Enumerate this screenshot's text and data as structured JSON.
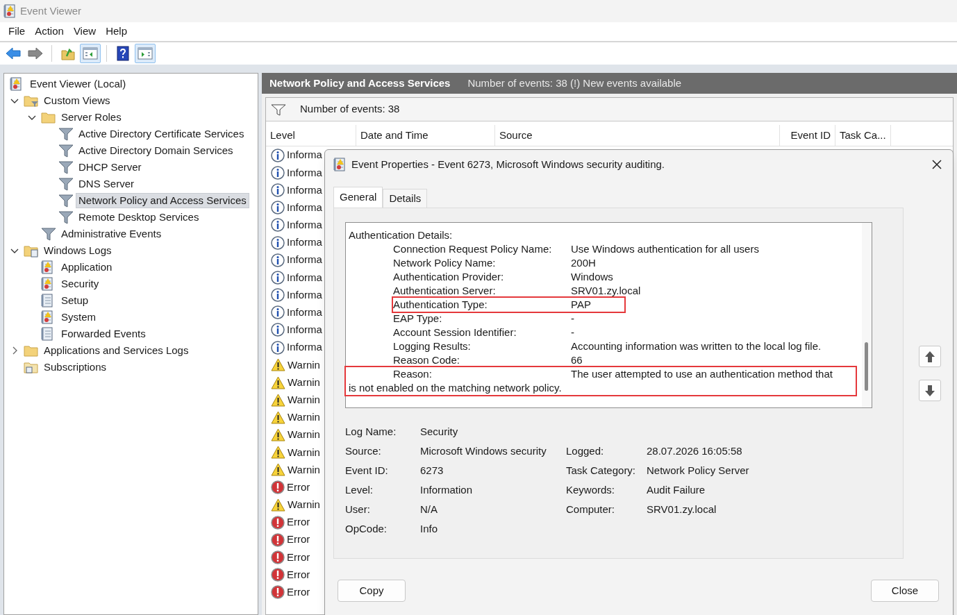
{
  "window": {
    "title": "Event Viewer"
  },
  "menu": [
    "File",
    "Action",
    "View",
    "Help"
  ],
  "toolbar": [
    {
      "kind": "back",
      "pressed": false
    },
    {
      "kind": "forward",
      "pressed": false
    },
    {
      "kind": "up",
      "pressed": false
    },
    {
      "kind": "tree",
      "pressed": true
    },
    {
      "kind": "help",
      "pressed": false
    },
    {
      "kind": "pane",
      "pressed": true
    }
  ],
  "tree": [
    {
      "label": "Event Viewer (Local)",
      "kind": "viewer",
      "selected": false,
      "children": [
        {
          "label": "Custom Views",
          "kind": "filterfolder",
          "selected": false,
          "expanded": true,
          "children": [
            {
              "label": "Server Roles",
              "kind": "folder",
              "selected": false,
              "expanded": true,
              "children": [
                {
                  "label": "Active Directory Certificate Services",
                  "kind": "filter",
                  "selected": false
                },
                {
                  "label": "Active Directory Domain Services",
                  "kind": "filter",
                  "selected": false
                },
                {
                  "label": "DHCP Server",
                  "kind": "filter",
                  "selected": false
                },
                {
                  "label": "DNS Server",
                  "kind": "filter",
                  "selected": false
                },
                {
                  "label": "Network Policy and Access Services",
                  "kind": "filter",
                  "selected": true
                },
                {
                  "label": "Remote Desktop Services",
                  "kind": "filter",
                  "selected": false
                }
              ]
            },
            {
              "label": "Administrative Events",
              "kind": "filter",
              "selected": false
            }
          ]
        },
        {
          "label": "Windows Logs",
          "kind": "logfolder",
          "selected": false,
          "expanded": true,
          "children": [
            {
              "label": "Application",
              "kind": "logwarn",
              "selected": false
            },
            {
              "label": "Security",
              "kind": "logwarn",
              "selected": false
            },
            {
              "label": "Setup",
              "kind": "log",
              "selected": false
            },
            {
              "label": "System",
              "kind": "logwarn",
              "selected": false
            },
            {
              "label": "Forwarded Events",
              "kind": "log",
              "selected": false
            }
          ]
        },
        {
          "label": "Applications and Services Logs",
          "kind": "folder",
          "selected": false,
          "expanded": false
        },
        {
          "label": "Subscriptions",
          "kind": "subscriptions",
          "selected": false
        }
      ]
    }
  ],
  "header": {
    "title": "Network Policy and Access Services",
    "info": "Number of events: 38 (!) New events available"
  },
  "filter_bar": {
    "text": "Number of events: 38"
  },
  "table": {
    "columns": [
      "Level",
      "Date and Time",
      "Source",
      "Event ID",
      "Task Ca..."
    ],
    "rows": [
      {
        "kind": "info",
        "text": "Informa"
      },
      {
        "kind": "info",
        "text": "Informa"
      },
      {
        "kind": "info",
        "text": "Informa"
      },
      {
        "kind": "info",
        "text": "Informa"
      },
      {
        "kind": "info",
        "text": "Informa"
      },
      {
        "kind": "info",
        "text": "Informa"
      },
      {
        "kind": "info",
        "text": "Informa"
      },
      {
        "kind": "info",
        "text": "Informa"
      },
      {
        "kind": "info",
        "text": "Informa"
      },
      {
        "kind": "info",
        "text": "Informa"
      },
      {
        "kind": "info",
        "text": "Informa"
      },
      {
        "kind": "info",
        "text": "Informa"
      },
      {
        "kind": "warning",
        "text": "Warnin"
      },
      {
        "kind": "warning",
        "text": "Warnin"
      },
      {
        "kind": "warning",
        "text": "Warnin"
      },
      {
        "kind": "warning",
        "text": "Warnin"
      },
      {
        "kind": "warning",
        "text": "Warnin"
      },
      {
        "kind": "warning",
        "text": "Warnin"
      },
      {
        "kind": "warning",
        "text": "Warnin"
      },
      {
        "kind": "error",
        "text": "Error"
      },
      {
        "kind": "warning",
        "text": "Warnin"
      },
      {
        "kind": "error",
        "text": "Error"
      },
      {
        "kind": "error",
        "text": "Error"
      },
      {
        "kind": "error",
        "text": "Error"
      },
      {
        "kind": "error",
        "text": "Error"
      },
      {
        "kind": "error",
        "text": "Error"
      }
    ]
  },
  "dialog": {
    "title": "Event Properties - Event 6273, Microsoft Windows security auditing.",
    "tabs": [
      {
        "label": "General",
        "selected": true
      },
      {
        "label": "Details",
        "selected": false
      }
    ],
    "description": {
      "heading": "Authentication Details:",
      "rows": [
        {
          "kind": "pair",
          "label": "Connection Request Policy Name:",
          "value": "Use Windows authentication for all users",
          "highlighted": false
        },
        {
          "kind": "pair",
          "label": "Network Policy Name:",
          "value": "200H",
          "highlighted": false
        },
        {
          "kind": "pair",
          "label": "Authentication Provider:",
          "value": "Windows",
          "highlighted": false
        },
        {
          "kind": "pair",
          "label": "Authentication Server:",
          "value": "SRV01.zy.local",
          "highlighted": false
        },
        {
          "kind": "pair",
          "label": "Authentication Type:",
          "value": "PAP",
          "highlighted": true
        },
        {
          "kind": "pair",
          "label": "EAP Type:",
          "value": "-",
          "highlighted": false
        },
        {
          "kind": "pair",
          "label": "Account Session Identifier:",
          "value": "-",
          "highlighted": false
        },
        {
          "kind": "pair",
          "label": "Logging Results:",
          "value": "Accounting information was written to the local log file.",
          "highlighted": false
        },
        {
          "kind": "pair",
          "label": "Reason Code:",
          "value": "66",
          "highlighted": false
        },
        {
          "kind": "wrap",
          "label": "Reason:",
          "value": "The user attempted to use an authentication method that",
          "continuation": "is not enabled on the matching network policy.",
          "highlighted": true
        }
      ]
    },
    "fields_left": [
      {
        "label": "Log Name:",
        "value": "Security"
      },
      {
        "label": "Source:",
        "value": "Microsoft Windows security"
      },
      {
        "label": "Event ID:",
        "value": "6273"
      },
      {
        "label": "Level:",
        "value": "Information"
      },
      {
        "label": "User:",
        "value": "N/A"
      },
      {
        "label": "OpCode:",
        "value": "Info"
      }
    ],
    "fields_right": [
      {
        "label": "Logged:",
        "value": "28.07.2026 16:05:58"
      },
      {
        "label": "Task Category:",
        "value": "Network Policy Server"
      },
      {
        "label": "Keywords:",
        "value": "Audit Failure"
      },
      {
        "label": "Computer:",
        "value": "SRV01.zy.local"
      }
    ],
    "buttons": {
      "copy": "Copy",
      "close": "Close"
    }
  }
}
